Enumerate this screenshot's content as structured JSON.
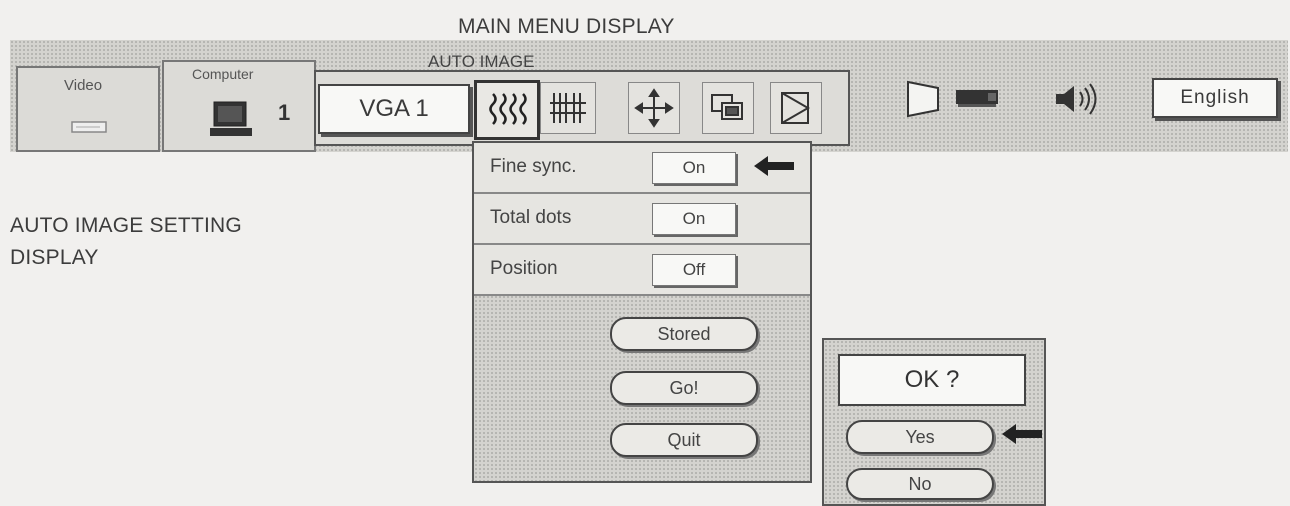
{
  "captions": {
    "main_menu": "MAIN MENU DISPLAY",
    "auto_image_setting_line1": "AUTO IMAGE SETTING",
    "auto_image_setting_line2": "DISPLAY"
  },
  "menubar": {
    "video_tab_label": "Video",
    "computer_tab_label": "Computer",
    "computer_number": "1",
    "auto_image_label": "AUTO IMAGE",
    "input_source": "VGA 1",
    "language": "English",
    "icons": [
      "auto-image-icon",
      "pc-adjust-icon",
      "image-select-icon",
      "screen-icon",
      "image-adjust-icon",
      "keystone-icon",
      "projector-icon",
      "sound-icon"
    ]
  },
  "auto_image_menu": {
    "rows": [
      {
        "label": "Fine sync.",
        "value": "On"
      },
      {
        "label": "Total dots",
        "value": "On"
      },
      {
        "label": "Position",
        "value": "Off"
      }
    ],
    "buttons": {
      "stored": "Stored",
      "go": "Go!",
      "quit": "Quit"
    }
  },
  "confirm_dialog": {
    "prompt": "OK ?",
    "yes": "Yes",
    "no": "No"
  },
  "colors": {
    "background": "#f1f0ee",
    "screen": "#d4d3cf",
    "text": "#3a3a3a",
    "frame": "#444444"
  }
}
